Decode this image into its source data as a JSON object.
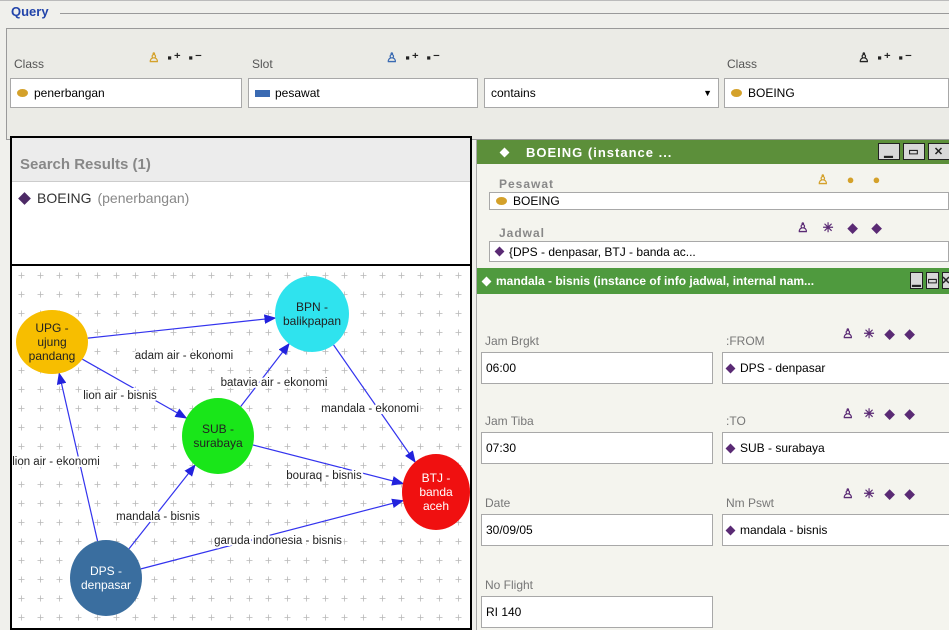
{
  "query": {
    "title": "Query",
    "class_label": "Class",
    "slot_label": "Slot",
    "class2_label": "Class",
    "class_value": "penerbangan",
    "slot_value": "pesawat",
    "operator_value": "contains",
    "class2_value": "BOEING"
  },
  "search_results": {
    "title": "Search Results (1)",
    "items": [
      {
        "name": "BOEING",
        "cls": "(penerbangan)"
      }
    ]
  },
  "graph": {
    "nodes": [
      {
        "id": "UPG",
        "lines": [
          "UPG -",
          "ujung",
          "pandang"
        ],
        "color": "#f7be00"
      },
      {
        "id": "BPN",
        "lines": [
          "BPN -",
          "balikpapan"
        ],
        "color": "#2fe3ee"
      },
      {
        "id": "SUB",
        "lines": [
          "SUB -",
          "surabaya"
        ],
        "color": "#19e619"
      },
      {
        "id": "BTJ",
        "lines": [
          "BTJ -",
          "banda",
          "aceh"
        ],
        "color": "#f01010"
      },
      {
        "id": "DPS",
        "lines": [
          "DPS -",
          "denpasar"
        ],
        "color": "#3a6e9f"
      }
    ],
    "edges": [
      {
        "from": "UPG",
        "to": "BPN",
        "label": "adam air - ekonomi"
      },
      {
        "from": "SUB",
        "to": "BPN",
        "label": "batavia air - ekonomi"
      },
      {
        "from": "UPG",
        "to": "SUB",
        "label": "lion air - bisnis"
      },
      {
        "from": "BPN",
        "to": "BTJ",
        "label": "mandala - ekonomi"
      },
      {
        "from": "DPS",
        "to": "UPG",
        "label": "lion air - ekonomi"
      },
      {
        "from": "SUB",
        "to": "BTJ",
        "label": "bouraq - bisnis"
      },
      {
        "from": "DPS",
        "to": "SUB",
        "label": "mandala - bisnis"
      },
      {
        "from": "DPS",
        "to": "BTJ",
        "label": "garuda indonesia - bisnis"
      }
    ]
  },
  "boeing_panel": {
    "title": "BOEING  (instance ...",
    "pesawat_label": "Pesawat",
    "pesawat_value": "BOEING",
    "jadwal_label": "Jadwal",
    "jadwal_value": "{DPS - denpasar, BTJ - banda ac..."
  },
  "mandala_panel": {
    "title": "mandala - bisnis   (instance of info jadwal, internal nam...",
    "jam_brgkt_label": "Jam Brgkt",
    "jam_brgkt_value": "06:00",
    "from_label": ":FROM",
    "from_value": "DPS - denpasar",
    "jam_tiba_label": "Jam Tiba",
    "jam_tiba_value": "07:30",
    "to_label": ":TO",
    "to_value": "SUB - surabaya",
    "date_label": "Date",
    "date_value": "30/09/05",
    "nm_pswt_label": "Nm Pswt",
    "nm_pswt_value": "mandala - bisnis",
    "no_flight_label": "No Flight",
    "no_flight_value": "RI 140"
  },
  "colors": {
    "panel_green": "#5c8f3a",
    "edge_blue": "#3333ee",
    "class_dot": "#d4a12a",
    "instance_diamond": "#4d2a66"
  }
}
